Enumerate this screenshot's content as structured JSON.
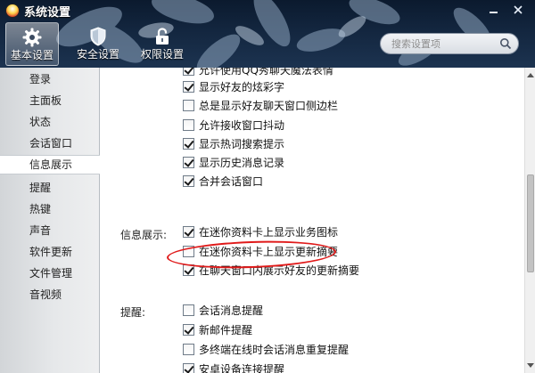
{
  "window": {
    "title": "系统设置",
    "icon": "qq-penguin-icon"
  },
  "toolbar": {
    "tabs": [
      {
        "label": "基本设置",
        "icon": "gear-icon",
        "active": true
      },
      {
        "label": "安全设置",
        "icon": "shield-icon",
        "active": false
      },
      {
        "label": "权限设置",
        "icon": "lock-icon",
        "active": false
      }
    ],
    "search_placeholder": "搜索设置项"
  },
  "sidebar": {
    "items": [
      {
        "label": "登录"
      },
      {
        "label": "主面板"
      },
      {
        "label": "状态"
      },
      {
        "label": "会话窗口"
      },
      {
        "label": "信息展示",
        "active": true
      },
      {
        "label": "提醒"
      },
      {
        "label": "热键"
      },
      {
        "label": "声音"
      },
      {
        "label": "软件更新"
      },
      {
        "label": "文件管理"
      },
      {
        "label": "音视频"
      }
    ]
  },
  "content": {
    "group_top": [
      {
        "label": "允许使用QQ秀聊天魔法表情",
        "checked": true
      },
      {
        "label": "显示好友的炫彩字",
        "checked": true
      },
      {
        "label": "总是显示好友聊天窗口侧边栏",
        "checked": false
      },
      {
        "label": "允许接收窗口抖动",
        "checked": false
      },
      {
        "label": "显示热词搜索提示",
        "checked": true
      },
      {
        "label": "显示历史消息记录",
        "checked": true
      },
      {
        "label": "合并会话窗口",
        "checked": true
      }
    ],
    "info_section": {
      "label": "信息展示:",
      "options": [
        {
          "label": "在迷你资料卡上显示业务图标",
          "checked": true
        },
        {
          "label": "在迷你资料卡上显示更新摘要",
          "checked": false
        },
        {
          "label": "在聊天窗口内展示好友的更新摘要",
          "checked": true
        }
      ]
    },
    "remind_section": {
      "label": "提醒:",
      "options": [
        {
          "label": "会话消息提醒",
          "checked": false
        },
        {
          "label": "新邮件提醒",
          "checked": true
        },
        {
          "label": "多终端在线时会话消息重复提醒",
          "checked": false
        },
        {
          "label": "安卓设备连接提醒",
          "checked": true
        }
      ]
    }
  },
  "colors": {
    "header_dark": "#0b1a2e",
    "annotation_red": "#e01a1a",
    "sidebar_bg": "#e6e8ea"
  }
}
